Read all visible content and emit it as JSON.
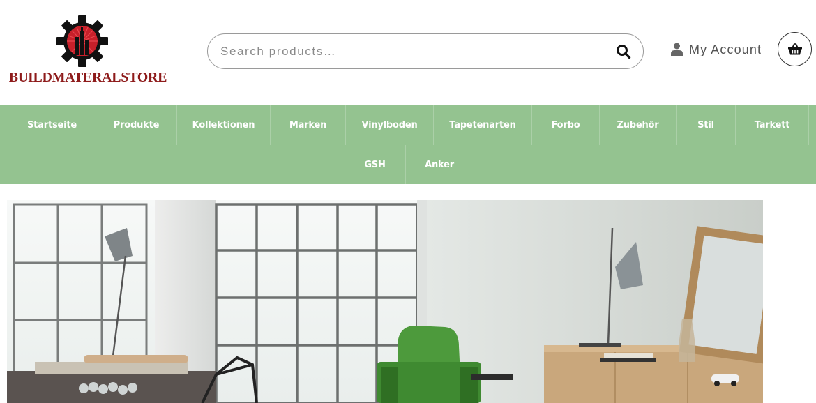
{
  "brand": {
    "name": "BUILDMATERALSTORE",
    "colors": {
      "name_text": "#8e1b1b",
      "gear": "#111111",
      "gear_center": "#c8202a"
    }
  },
  "search": {
    "placeholder": "Search products…",
    "icon": "search-icon"
  },
  "account": {
    "label": "My Account",
    "icon": "user-icon"
  },
  "cart": {
    "icon": "basket-icon"
  },
  "nav": {
    "background": "#94c390",
    "row1": [
      {
        "label": "Startseite"
      },
      {
        "label": "Produkte"
      },
      {
        "label": "Kollektionen"
      },
      {
        "label": "Marken"
      },
      {
        "label": "Vinylboden"
      },
      {
        "label": "Tapetenarten"
      },
      {
        "label": "Forbo"
      },
      {
        "label": "Zubehör"
      },
      {
        "label": "Stil"
      },
      {
        "label": "Tarkett"
      }
    ],
    "row2": [
      {
        "label": "GSH"
      },
      {
        "label": "Anker"
      }
    ]
  },
  "hero": {
    "image": "interior-loft-banner"
  }
}
